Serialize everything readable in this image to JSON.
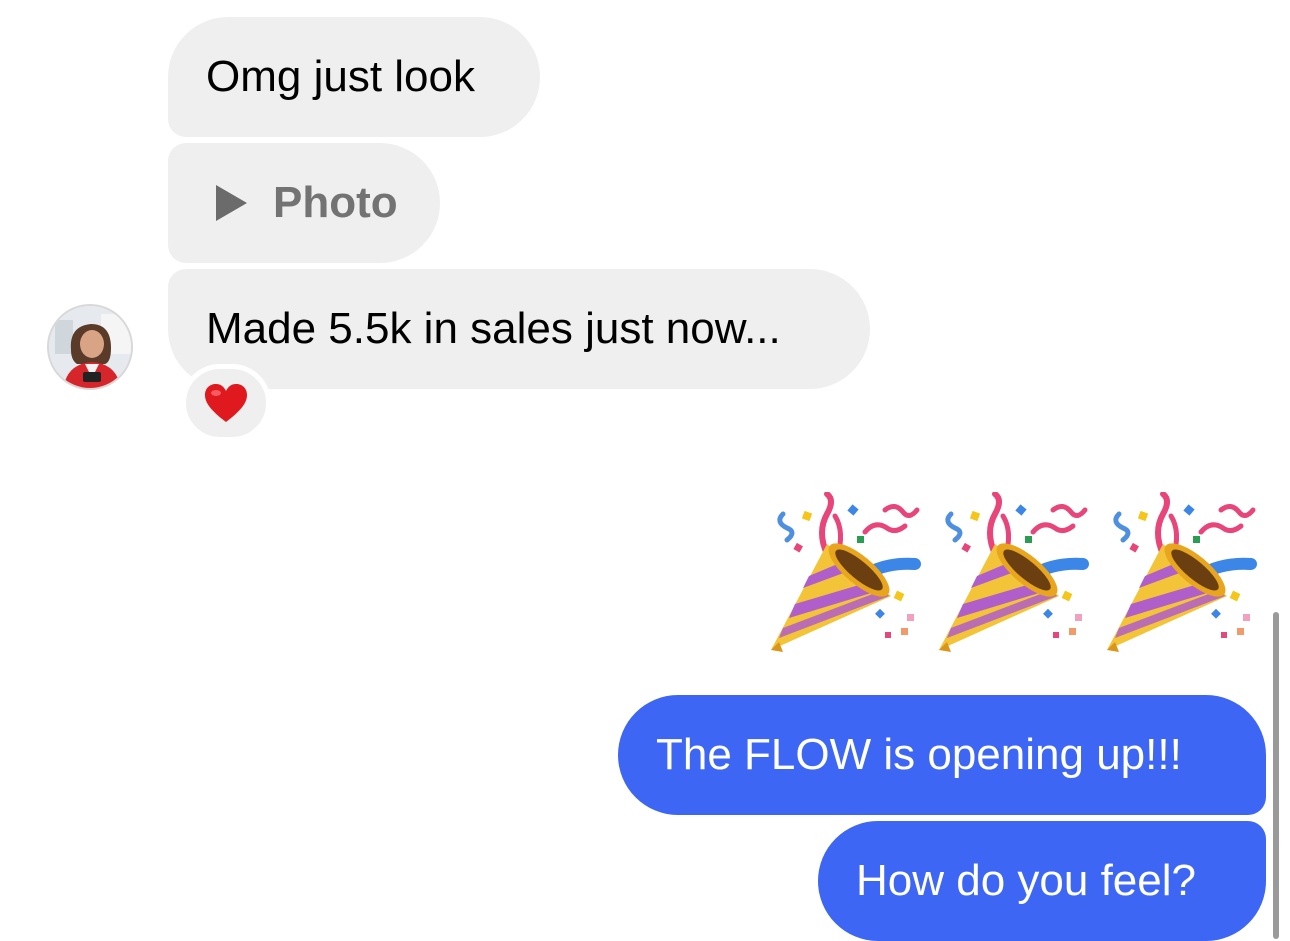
{
  "messages": {
    "incoming": [
      {
        "text": "Omg just look"
      },
      {
        "attachment_icon": "play-icon",
        "text": "Photo"
      },
      {
        "text": "Made 5.5k in sales just now...",
        "reaction": "heart"
      }
    ],
    "outgoing_emoji": [
      "party-popper",
      "party-popper",
      "party-popper"
    ],
    "outgoing": [
      {
        "text": "The FLOW is opening up!!!"
      },
      {
        "text": "How do you feel?"
      }
    ]
  },
  "colors": {
    "incoming_bubble": "#efefef",
    "outgoing_bubble": "#3d66f5",
    "background": "#ffffff",
    "heart": "#e0191e"
  }
}
